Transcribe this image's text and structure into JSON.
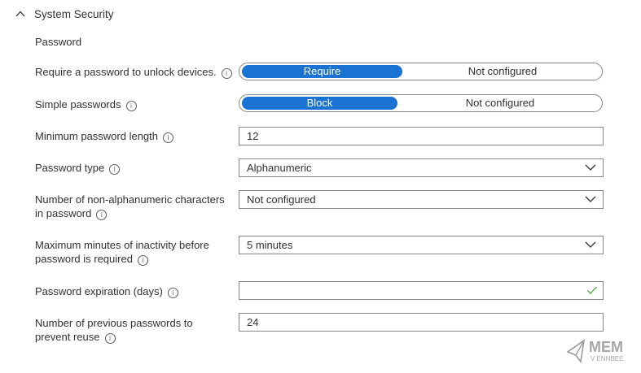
{
  "section": {
    "title": "System Security"
  },
  "subsection": "Password",
  "settings": {
    "require_password": {
      "label": "Require a password to unlock devices.",
      "options": [
        "Require",
        "Not configured"
      ],
      "selected": "Require"
    },
    "simple_passwords": {
      "label": "Simple passwords",
      "options": [
        "Block",
        "Not configured"
      ],
      "selected": "Block"
    },
    "min_length": {
      "label": "Minimum password length",
      "value": "12"
    },
    "password_type": {
      "label": "Password type",
      "value": "Alphanumeric"
    },
    "non_alnum": {
      "label_line1": "Number of non-alphanumeric characters",
      "label_line2": "in password",
      "value": "Not configured"
    },
    "max_inactivity": {
      "label_line1": "Maximum minutes of inactivity before",
      "label_line2": "password is required",
      "value": "5 minutes"
    },
    "expiration": {
      "label": "Password expiration (days)",
      "value": ""
    },
    "previous": {
      "label_line1": "Number of previous passwords to",
      "label_line2": "prevent reuse",
      "value": "24"
    }
  },
  "watermark": {
    "line1": "MEM",
    "line2": "V ENNBEE"
  },
  "colors": {
    "accent": "#1a73d2",
    "valid": "#5ea853"
  }
}
